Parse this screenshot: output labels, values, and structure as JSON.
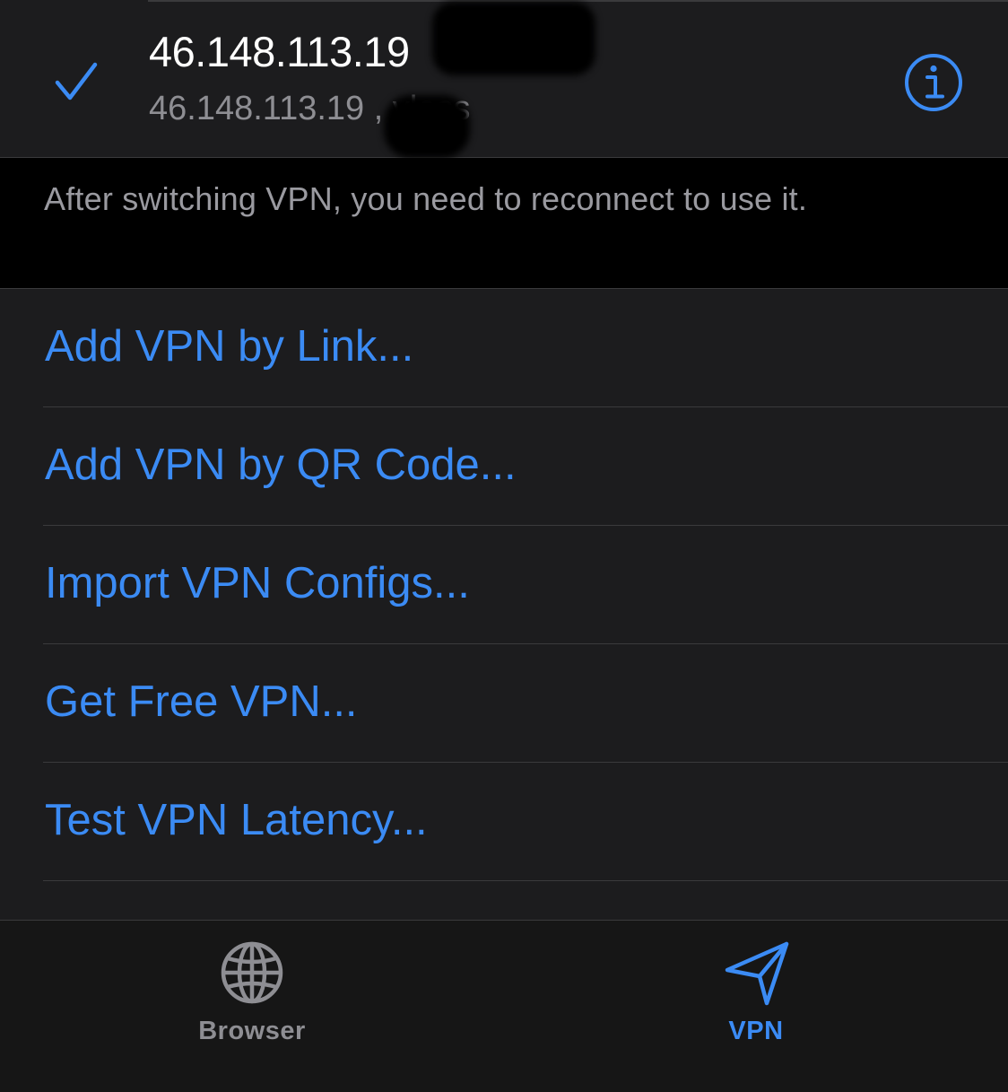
{
  "colors": {
    "accent": "#3b8bf4",
    "cell_background": "#1c1c1e",
    "page_background": "#000000",
    "separator": "#3a3a3c",
    "secondary_text": "#8e8e93",
    "tab_bar_background": "#161616"
  },
  "selected_server": {
    "title": "46.148.113.19",
    "subtitle": "46.148.113.19        , vless",
    "check_icon": "checkmark-icon",
    "info_icon": "info-circle-icon"
  },
  "section_footer": "After switching VPN, you need to reconnect to use it.",
  "actions": [
    {
      "label": "Add VPN by Link..."
    },
    {
      "label": "Add VPN by QR Code..."
    },
    {
      "label": "Import VPN Configs..."
    },
    {
      "label": "Get Free VPN..."
    },
    {
      "label": "Test VPN Latency..."
    }
  ],
  "tab_bar": {
    "tabs": [
      {
        "label": "Browser",
        "icon": "globe-icon",
        "selected": false
      },
      {
        "label": "VPN",
        "icon": "paper-plane-icon",
        "selected": true
      }
    ]
  }
}
